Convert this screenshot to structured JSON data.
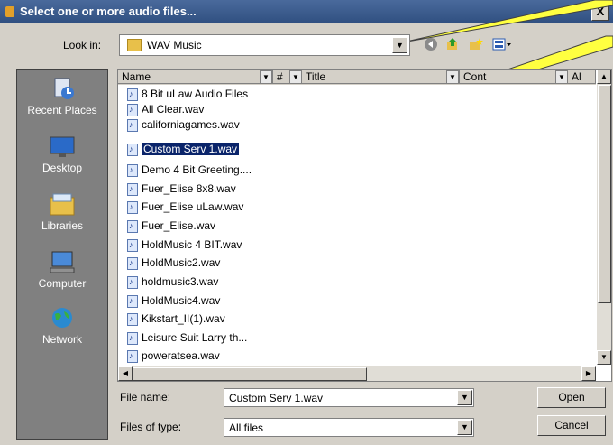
{
  "window": {
    "title": "Select one or more audio files...",
    "close_label": "X"
  },
  "look_in": {
    "label": "Look in:",
    "value": "WAV Music"
  },
  "places": [
    {
      "label": "Recent Places"
    },
    {
      "label": "Desktop"
    },
    {
      "label": "Libraries"
    },
    {
      "label": "Computer"
    },
    {
      "label": "Network"
    }
  ],
  "columns": {
    "name": "Name",
    "number": "#",
    "title": "Title",
    "contributing": "Cont",
    "album": "Al"
  },
  "files": [
    {
      "name": "8 Bit uLaw Audio Files",
      "type": "shortcut"
    },
    {
      "name": "All Clear.wav",
      "type": "wav"
    },
    {
      "name": "californiagames.wav",
      "type": "wav"
    },
    {
      "name": "Custom Serv 1.wav",
      "type": "wav",
      "selected": true
    },
    {
      "name": "Demo 4 Bit Greeting....",
      "type": "wav"
    },
    {
      "name": "Fuer_Elise 8x8.wav",
      "type": "wav"
    },
    {
      "name": "Fuer_Elise uLaw.wav",
      "type": "wav"
    },
    {
      "name": "Fuer_Elise.wav",
      "type": "wav"
    },
    {
      "name": "HoldMusic 4 BIT.wav",
      "type": "wav"
    },
    {
      "name": "HoldMusic2.wav",
      "type": "wav"
    },
    {
      "name": "holdmusic3.wav",
      "type": "wav"
    },
    {
      "name": "HoldMusic4.wav",
      "type": "wav"
    },
    {
      "name": "Kikstart_II(1).wav",
      "type": "wav"
    },
    {
      "name": "Leisure Suit Larry th...",
      "type": "wav"
    },
    {
      "name": "poweratsea.wav",
      "type": "wav"
    }
  ],
  "file_name": {
    "label": "File name:",
    "value": "Custom Serv 1.wav"
  },
  "files_of_type": {
    "label": "Files of type:",
    "value": "All files"
  },
  "buttons": {
    "open": "Open",
    "cancel": "Cancel"
  },
  "colors": {
    "selection": "#0a246a",
    "callout": "#ffff40",
    "sidebar": "#808080"
  }
}
